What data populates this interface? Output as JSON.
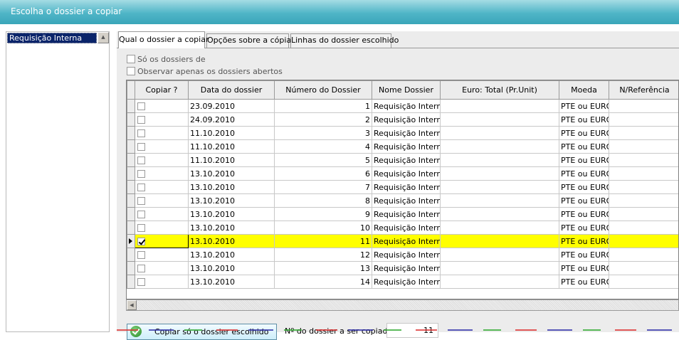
{
  "window": {
    "title": "Escolha o dossier a copiar"
  },
  "sidebar": {
    "items": [
      {
        "label": "Requisição Interna"
      }
    ]
  },
  "tabs": [
    {
      "label": "Qual o dossier a copiar",
      "active": true
    },
    {
      "label": "Opções sobre a cópia",
      "active": false
    },
    {
      "label": "Linhas do dossier escolhido",
      "active": false
    }
  ],
  "filters": {
    "only_dossiers_label": "Só os dossiers de",
    "only_open_label": "Observar apenas os dossiers abertos"
  },
  "grid": {
    "columns": [
      "Copiar ?",
      "Data do dossier",
      "Número do Dossier",
      "Nome Dossier",
      "Euro: Total (Pr.Unit)",
      "Moeda",
      "N/Referência"
    ],
    "rows": [
      {
        "copy": false,
        "date": "23.09.2010",
        "number": "1",
        "name": "Requisição Interna",
        "total": "",
        "currency": "PTE ou EURO",
        "ref": ""
      },
      {
        "copy": false,
        "date": "24.09.2010",
        "number": "2",
        "name": "Requisição Interna",
        "total": "",
        "currency": "PTE ou EURO",
        "ref": ""
      },
      {
        "copy": false,
        "date": "11.10.2010",
        "number": "3",
        "name": "Requisição Interna",
        "total": "",
        "currency": "PTE ou EURO",
        "ref": ""
      },
      {
        "copy": false,
        "date": "11.10.2010",
        "number": "4",
        "name": "Requisição Interna",
        "total": "",
        "currency": "PTE ou EURO",
        "ref": ""
      },
      {
        "copy": false,
        "date": "11.10.2010",
        "number": "5",
        "name": "Requisição Interna",
        "total": "",
        "currency": "PTE ou EURO",
        "ref": ""
      },
      {
        "copy": false,
        "date": "13.10.2010",
        "number": "6",
        "name": "Requisição Interna",
        "total": "",
        "currency": "PTE ou EURO",
        "ref": ""
      },
      {
        "copy": false,
        "date": "13.10.2010",
        "number": "7",
        "name": "Requisição Interna",
        "total": "",
        "currency": "PTE ou EURO",
        "ref": ""
      },
      {
        "copy": false,
        "date": "13.10.2010",
        "number": "8",
        "name": "Requisição Interna",
        "total": "",
        "currency": "PTE ou EURO",
        "ref": ""
      },
      {
        "copy": false,
        "date": "13.10.2010",
        "number": "9",
        "name": "Requisição Interna",
        "total": "",
        "currency": "PTE ou EURO",
        "ref": ""
      },
      {
        "copy": false,
        "date": "13.10.2010",
        "number": "10",
        "name": "Requisição Interna",
        "total": "",
        "currency": "PTE ou EURO",
        "ref": ""
      },
      {
        "copy": true,
        "date": "13.10.2010",
        "number": "11",
        "name": "Requisição Interna",
        "total": "",
        "currency": "PTE ou EURO",
        "ref": "",
        "selected": true
      },
      {
        "copy": false,
        "date": "13.10.2010",
        "number": "12",
        "name": "Requisição Interna",
        "total": "",
        "currency": "PTE ou EURO",
        "ref": ""
      },
      {
        "copy": false,
        "date": "13.10.2010",
        "number": "13",
        "name": "Requisição Interna",
        "total": "",
        "currency": "PTE ou EURO",
        "ref": ""
      },
      {
        "copy": false,
        "date": "13.10.2010",
        "number": "14",
        "name": "Requisição Interna",
        "total": "",
        "currency": "PTE ou EURO",
        "ref": ""
      }
    ]
  },
  "footer": {
    "copy_button_label": "Copiar só o dossier escolhido",
    "copy_button_icon": "check-circle-icon",
    "dossier_number_label": "Nº do dossier a ser copiado",
    "dossier_number_value": "11"
  },
  "colors": {
    "title_bar": "#4fb5c7",
    "selection_highlight": "#ffff00",
    "sidebar_selection": "#0a246a"
  }
}
